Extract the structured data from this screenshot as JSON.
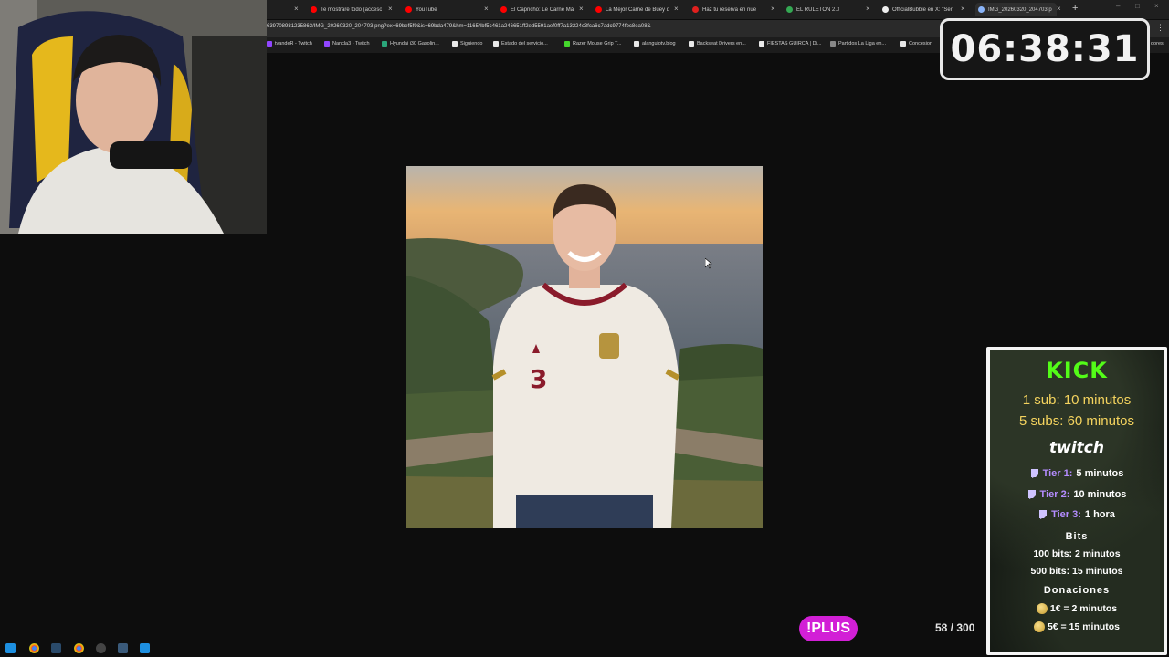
{
  "browser": {
    "tabs": [
      {
        "label": "Te mostraré todo (acceso",
        "color": "#ff0000"
      },
      {
        "label": "YouTube",
        "color": "#ff0000"
      },
      {
        "label": "El Capricho: Le Carne Más",
        "color": "#ff0000"
      },
      {
        "label": "La Mejor Carne de Buey d",
        "color": "#ff0000"
      },
      {
        "label": "Haz tu reserva en nue",
        "color": "#e0201e"
      },
      {
        "label": "EL RULETON 2.0",
        "color": "#34a853"
      },
      {
        "label": "OfficialBubble en X: \"Seri",
        "color": "#111111"
      },
      {
        "label": "IMG_20260320_204703.p",
        "color": "#8ab4f8"
      }
    ],
    "url": "639708981235863/IMG_20260320_204703.png?ex=69bef5f9&is=69bda479&hm=11654bf5c461a246651ff2ed5591aef0ff7a13224c3fca6c7adc9774fbc8ea08&",
    "bookmarks": [
      {
        "label": "tvandeR - Twitch",
        "color": "#9146ff"
      },
      {
        "label": "Nancla3 - Twitch",
        "color": "#9146ff"
      },
      {
        "label": "Hyundai i30 Gasolin...",
        "color": "#2aa57a"
      },
      {
        "label": "Siguiendo",
        "color": "#e8e8e8"
      },
      {
        "label": "Estado del servicio...",
        "color": "#e8e8e8"
      },
      {
        "label": "Razer Mouse Grip T...",
        "color": "#44d62c"
      },
      {
        "label": "alangulotv.blog",
        "color": "#e8e8e8"
      },
      {
        "label": "Backseat Drivers en...",
        "color": "#e8e8e8"
      },
      {
        "label": "FIESTAS GUIRCA | Di...",
        "color": "#e8e8e8"
      },
      {
        "label": "Partidos La Liga en...",
        "color": "#888888"
      },
      {
        "label": "Concesion",
        "color": "#e8e8e8"
      },
      {
        "label": "dores",
        "color": "#e8e8e8"
      }
    ]
  },
  "timer": {
    "value": "06:38:31"
  },
  "overlay": {
    "plus_label": "!PLUS",
    "counter": "58 / 300"
  },
  "panel": {
    "kick_title": "KICK",
    "kick_line1": "1 sub: 10 minutos",
    "kick_line2": "5 subs: 60 minutos",
    "twitch_title": "twitch",
    "tiers": [
      {
        "name": "Tier 1:",
        "value": "5 minutos"
      },
      {
        "name": "Tier 2:",
        "value": "10 minutos"
      },
      {
        "name": "Tier 3:",
        "value": "1 hora"
      }
    ],
    "bits_title": "Bits",
    "bits_line1": "100 bits: 2 minutos",
    "bits_line2": "500 bits: 15 minutos",
    "donations_title": "Donaciones",
    "don_line1": "1€ = 2 minutos",
    "don_line2": "5€ = 15 minutos",
    "colors": {
      "kick": "#53fc18",
      "tier": "#b48cff",
      "kick_text": "#f4d35e"
    }
  }
}
